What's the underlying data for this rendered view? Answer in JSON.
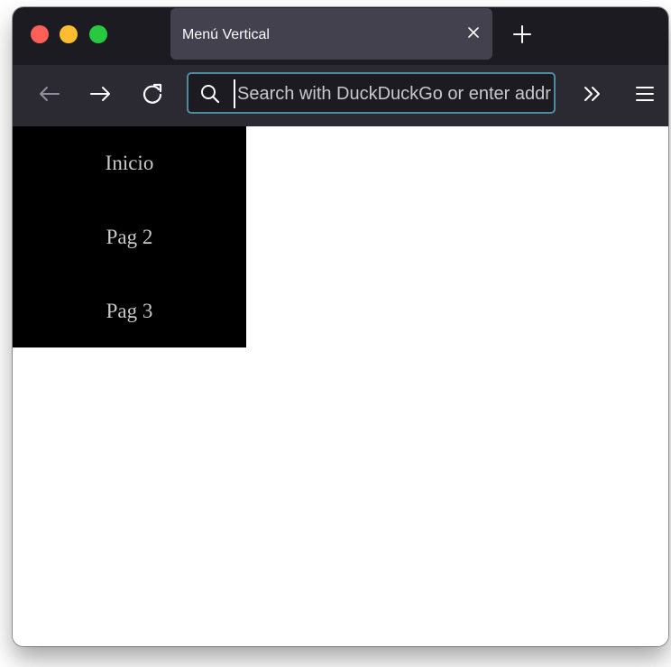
{
  "browser": {
    "tab": {
      "title": "Menú Vertical"
    },
    "urlbar": {
      "placeholder": "Search with DuckDuckGo or enter address",
      "value": ""
    }
  },
  "page": {
    "menu": {
      "items": [
        {
          "label": "Inicio"
        },
        {
          "label": "Pag 2"
        },
        {
          "label": "Pag 3"
        }
      ]
    }
  },
  "colors": {
    "tabstrip_bg": "#1c1b22",
    "toolbar_bg": "#2b2a33",
    "active_tab_bg": "#42414d",
    "urlbar_border": "#4f8ba0",
    "menu_bg": "#000000",
    "menu_text": "#c9c9c9",
    "close_button": "#fe5f57",
    "minimize_button": "#febc2e",
    "zoom_button": "#28c840"
  },
  "icons": {
    "window_controls": [
      "close-window-icon",
      "minimize-window-icon",
      "zoom-window-icon"
    ],
    "tab": [
      "close-tab-icon",
      "new-tab-icon"
    ],
    "toolbar": [
      "back-arrow-icon",
      "forward-arrow-icon",
      "reload-icon",
      "search-icon",
      "overflow-chevrons-icon",
      "hamburger-menu-icon"
    ]
  }
}
